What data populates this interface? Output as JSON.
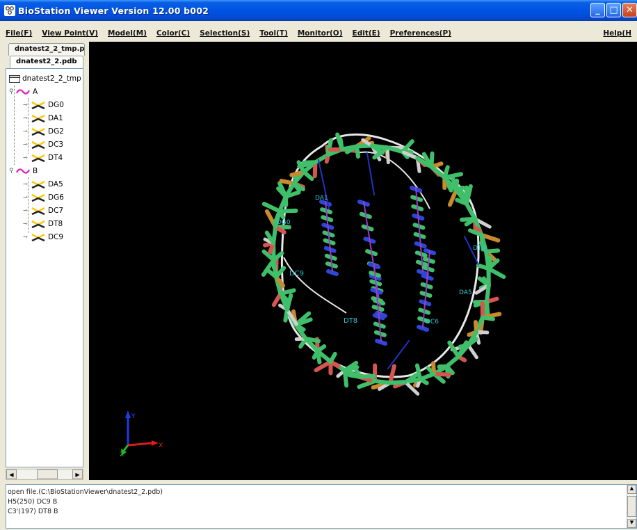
{
  "window": {
    "title": "BioStation Viewer Version 12.00 b002",
    "minimize_glyph": "_",
    "maximize_glyph": "□",
    "close_glyph": "✕"
  },
  "menu": {
    "items": [
      "File(F)",
      "View Point(V)",
      "Model(M)",
      "Color(C)",
      "Selection(S)",
      "Tool(T)",
      "Monitor(O)",
      "Edit(E)",
      "Preferences(P)"
    ],
    "help": "Help(H"
  },
  "tabs": [
    "dnatest2_2_tmp.p",
    "dnatest2_2.pdb"
  ],
  "tree": {
    "root": "dnatest2_2_tmp",
    "chains": [
      {
        "name": "A",
        "residues": [
          "DG0",
          "DA1",
          "DG2",
          "DC3",
          "DT4"
        ]
      },
      {
        "name": "B",
        "residues": [
          "DA5",
          "DG6",
          "DC7",
          "DT8",
          "DC9"
        ]
      }
    ]
  },
  "viewer": {
    "labels": [
      "DA1",
      "DG0",
      "DC9",
      "DT4",
      "DA5",
      "DT8",
      "DC6"
    ],
    "axes": [
      "Y",
      "X",
      "Z"
    ]
  },
  "console": {
    "lines": [
      "open file.(C:\\BioStationViewer\\dnatest2_2.pdb)",
      "H5(250) DC9 B",
      "C3'(197) DT8 B"
    ]
  },
  "colors": {
    "carbon": "#3fbf6a",
    "oxygen": "#d4564f",
    "nitrogen": "#3046d8",
    "phosphorus": "#c9892d",
    "hydrogen": "#cfcfcf",
    "chain_tree": "#e01cbd",
    "label": "#29c7d4"
  }
}
